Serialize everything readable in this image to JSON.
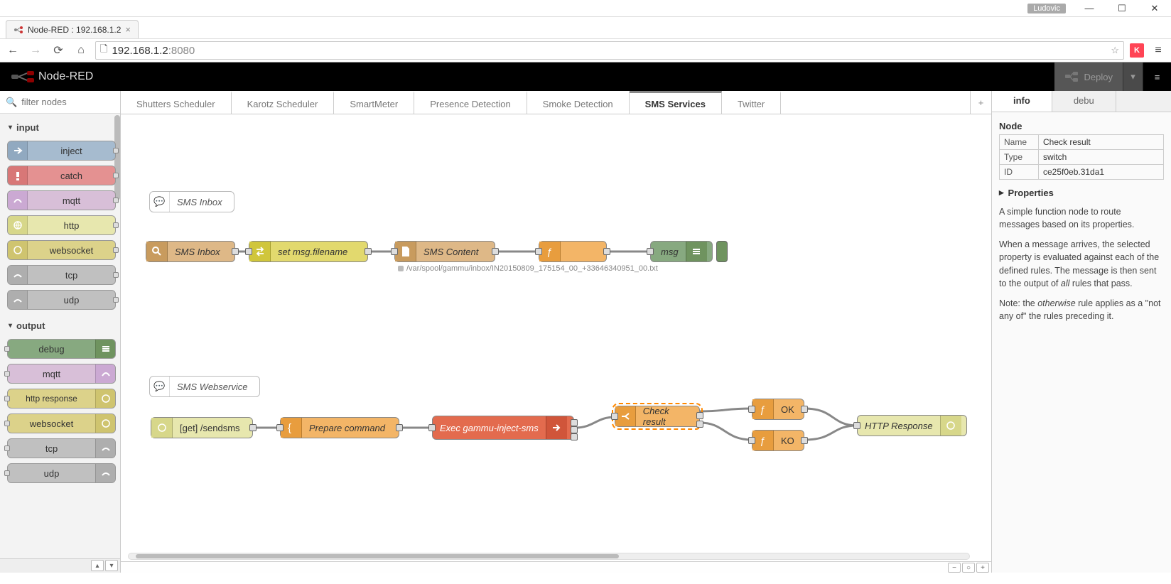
{
  "window": {
    "user_badge": "Ludovic"
  },
  "browser": {
    "tab_title": "Node-RED : 192.168.1.2",
    "url_host": "192.168.1.2",
    "url_port": ":8080"
  },
  "header": {
    "title": "Node-RED",
    "deploy_label": "Deploy"
  },
  "palette": {
    "filter_placeholder": "filter nodes",
    "cat_input": "input",
    "cat_output": "output",
    "input_nodes": [
      "inject",
      "catch",
      "mqtt",
      "http",
      "websocket",
      "tcp",
      "udp"
    ],
    "output_nodes": [
      "debug",
      "mqtt",
      "http response",
      "websocket",
      "tcp",
      "udp"
    ]
  },
  "tabs": [
    "Shutters Scheduler",
    "Karotz Scheduler",
    "SmartMeter",
    "Presence Detection",
    "Smoke Detection",
    "SMS Services",
    "Twitter"
  ],
  "active_tab_index": 5,
  "flow": {
    "comment1": "SMS Inbox",
    "comment2": "SMS Webservice",
    "n_watch": "SMS Inbox",
    "n_setfn": "set msg.filename",
    "n_content": "SMS Content",
    "n_func_blank": "",
    "n_msg": "msg",
    "status_path": "/var/spool/gammu/inbox/IN20150809_175154_00_+33646340951_00.txt",
    "n_http_in": "[get] /sendsms",
    "n_prepare": "Prepare command",
    "n_exec": "Exec gammu-inject-sms",
    "n_check": "Check result",
    "n_ok": "OK",
    "n_ko": "KO",
    "n_http_out": "HTTP Response"
  },
  "sidebar": {
    "tab_info": "info",
    "tab_debug": "debu",
    "section_node": "Node",
    "name_label": "Name",
    "name_val": "Check result",
    "type_label": "Type",
    "type_val": "switch",
    "id_label": "ID",
    "id_val": "ce25f0eb.31da1",
    "properties": "Properties",
    "p1": "A simple function node to route messages based on its properties.",
    "p2a": "When a message arrives, the selected property is evaluated against each of the defined rules. The message is then sent to the output of ",
    "p2_em": "all",
    "p2b": " rules that pass.",
    "p3a": "Note: the ",
    "p3_em": "otherwise",
    "p3b": " rule applies as a \"not any of\" the rules preceding it."
  }
}
